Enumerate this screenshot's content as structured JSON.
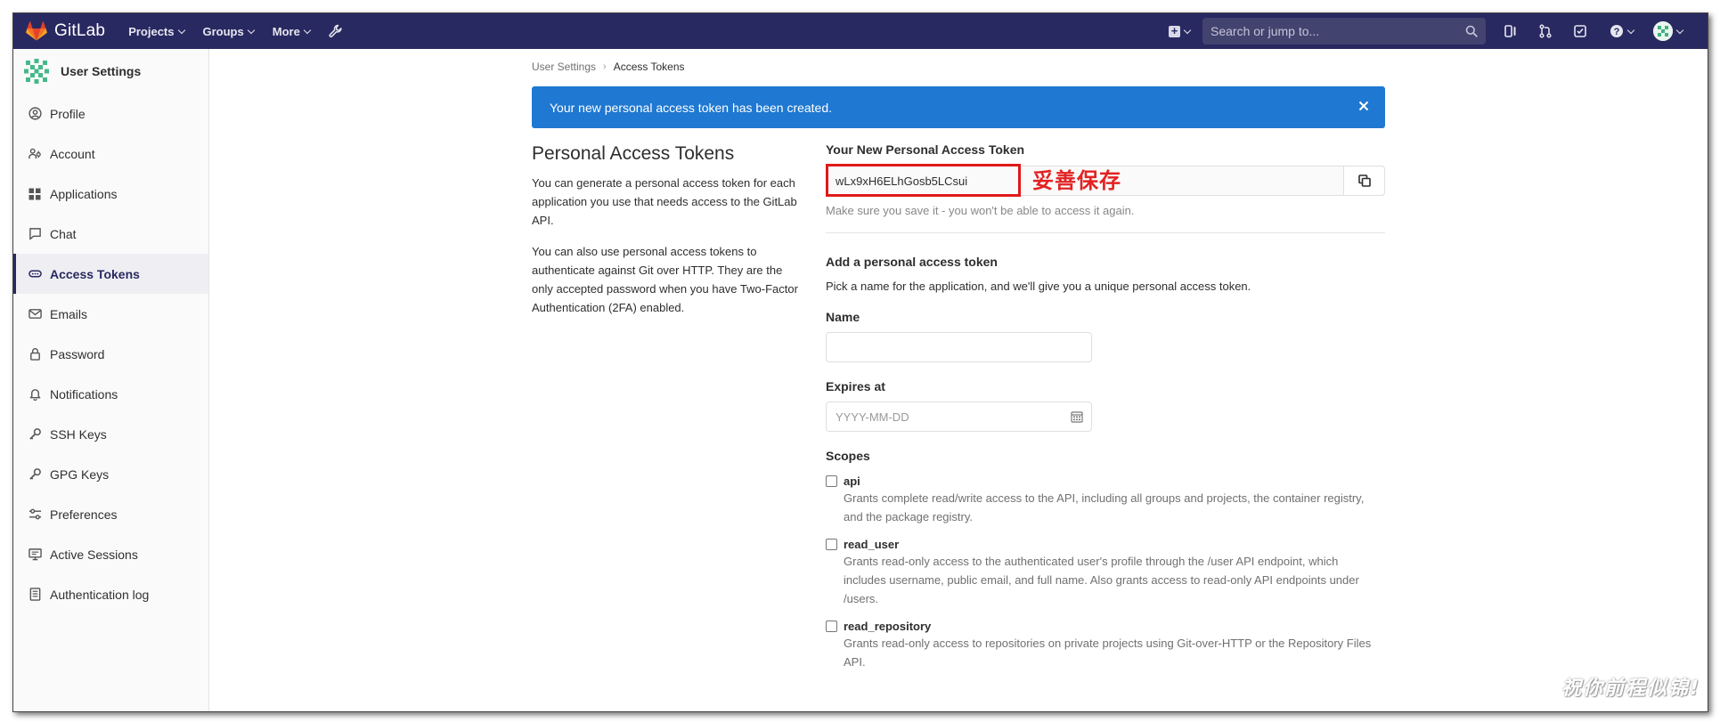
{
  "navbar": {
    "brand": "GitLab",
    "menu": [
      {
        "label": "Projects"
      },
      {
        "label": "Groups"
      },
      {
        "label": "More"
      }
    ],
    "search_placeholder": "Search or jump to...",
    "bg_color": "#292961"
  },
  "sidebar": {
    "title": "User Settings",
    "items": [
      {
        "label": "Profile",
        "icon": "profile-icon"
      },
      {
        "label": "Account",
        "icon": "account-icon"
      },
      {
        "label": "Applications",
        "icon": "applications-icon"
      },
      {
        "label": "Chat",
        "icon": "chat-icon"
      },
      {
        "label": "Access Tokens",
        "icon": "access-tokens-icon",
        "active": true
      },
      {
        "label": "Emails",
        "icon": "emails-icon"
      },
      {
        "label": "Password",
        "icon": "lock-icon"
      },
      {
        "label": "Notifications",
        "icon": "bell-icon"
      },
      {
        "label": "SSH Keys",
        "icon": "key-icon"
      },
      {
        "label": "GPG Keys",
        "icon": "key-icon"
      },
      {
        "label": "Preferences",
        "icon": "preferences-icon"
      },
      {
        "label": "Active Sessions",
        "icon": "monitor-icon"
      },
      {
        "label": "Authentication log",
        "icon": "log-icon"
      }
    ]
  },
  "breadcrumb": {
    "parent": "User Settings",
    "current": "Access Tokens"
  },
  "alert": {
    "message": "Your new personal access token has been created.",
    "color": "#1f78d1"
  },
  "intro": {
    "title": "Personal Access Tokens",
    "p1": "You can generate a personal access token for each application you use that needs access to the GitLab API.",
    "p2": "You can also use personal access tokens to authenticate against Git over HTTP. They are the only accepted password when you have Two-Factor Authentication (2FA) enabled."
  },
  "new_token": {
    "label": "Your New Personal Access Token",
    "value": "wLx9xH6ELhGosb5LCsui",
    "annotation": "妥善保存",
    "help": "Make sure you save it - you won't be able to access it again."
  },
  "add_token": {
    "heading": "Add a personal access token",
    "subtext": "Pick a name for the application, and we'll give you a unique personal access token.",
    "name_label": "Name",
    "name_value": "",
    "expires_label": "Expires at",
    "expires_placeholder": "YYYY-MM-DD",
    "scopes_label": "Scopes",
    "scopes": [
      {
        "name": "api",
        "checked": false,
        "description": "Grants complete read/write access to the API, including all groups and projects, the container registry, and the package registry."
      },
      {
        "name": "read_user",
        "checked": false,
        "description": "Grants read-only access to the authenticated user's profile through the /user API endpoint, which includes username, public email, and full name. Also grants access to read-only API endpoints under /users."
      },
      {
        "name": "read_repository",
        "checked": false,
        "description": "Grants read-only access to repositories on private projects using Git-over-HTTP or the Repository Files API."
      }
    ]
  },
  "watermark": "祝你前程似锦!"
}
